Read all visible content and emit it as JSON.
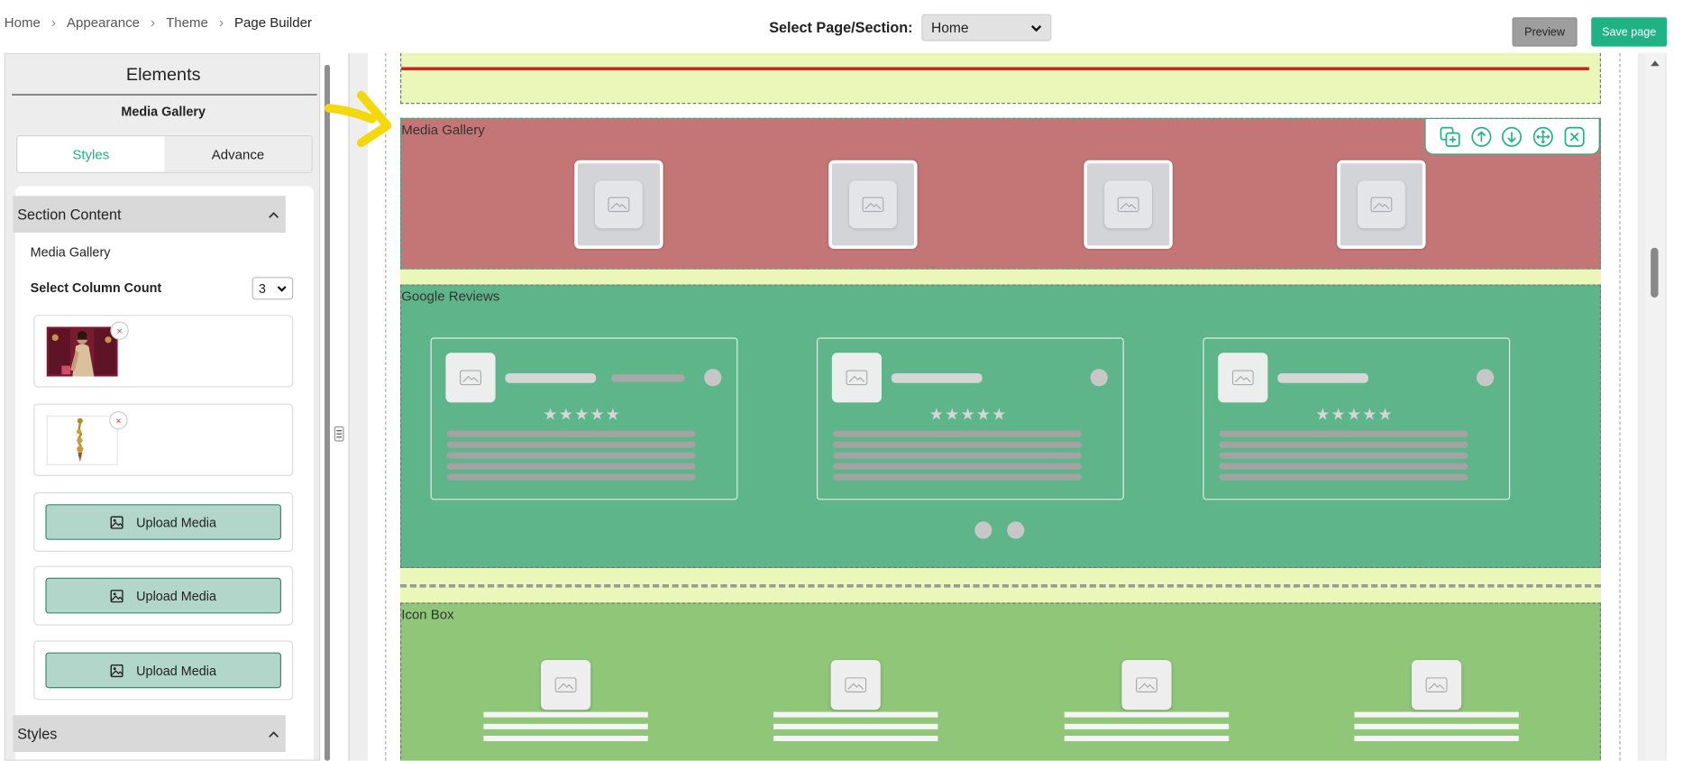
{
  "breadcrumb": [
    "Home",
    "Appearance",
    "Theme",
    "Page Builder"
  ],
  "header": {
    "select_label": "Select Page/Section:",
    "select_value": "Home",
    "preview_label": "Preview",
    "save_label": "Save page"
  },
  "sidebar": {
    "title": "Elements",
    "subtitle": "Media Gallery",
    "tabs": [
      "Styles",
      "Advance"
    ],
    "section_content": {
      "title": "Section Content",
      "gallery_label": "Media Gallery",
      "column_label": "Select Column Count",
      "column_value": "3",
      "remove_symbol": "×",
      "upload_label": "Upload Media"
    },
    "styles_title": "Styles"
  },
  "canvas": {
    "sections": [
      "Media Gallery",
      "Google Reviews",
      "Icon Box"
    ],
    "stars": "★★★★★"
  },
  "colors": {
    "accent": "#1fb384",
    "media_gallery_bg": "#c47676",
    "google_reviews_bg": "#5fb58a",
    "icon_box_bg": "#8fc678",
    "spacer_bg": "#ebf7b9",
    "divider_red": "#c62828"
  }
}
